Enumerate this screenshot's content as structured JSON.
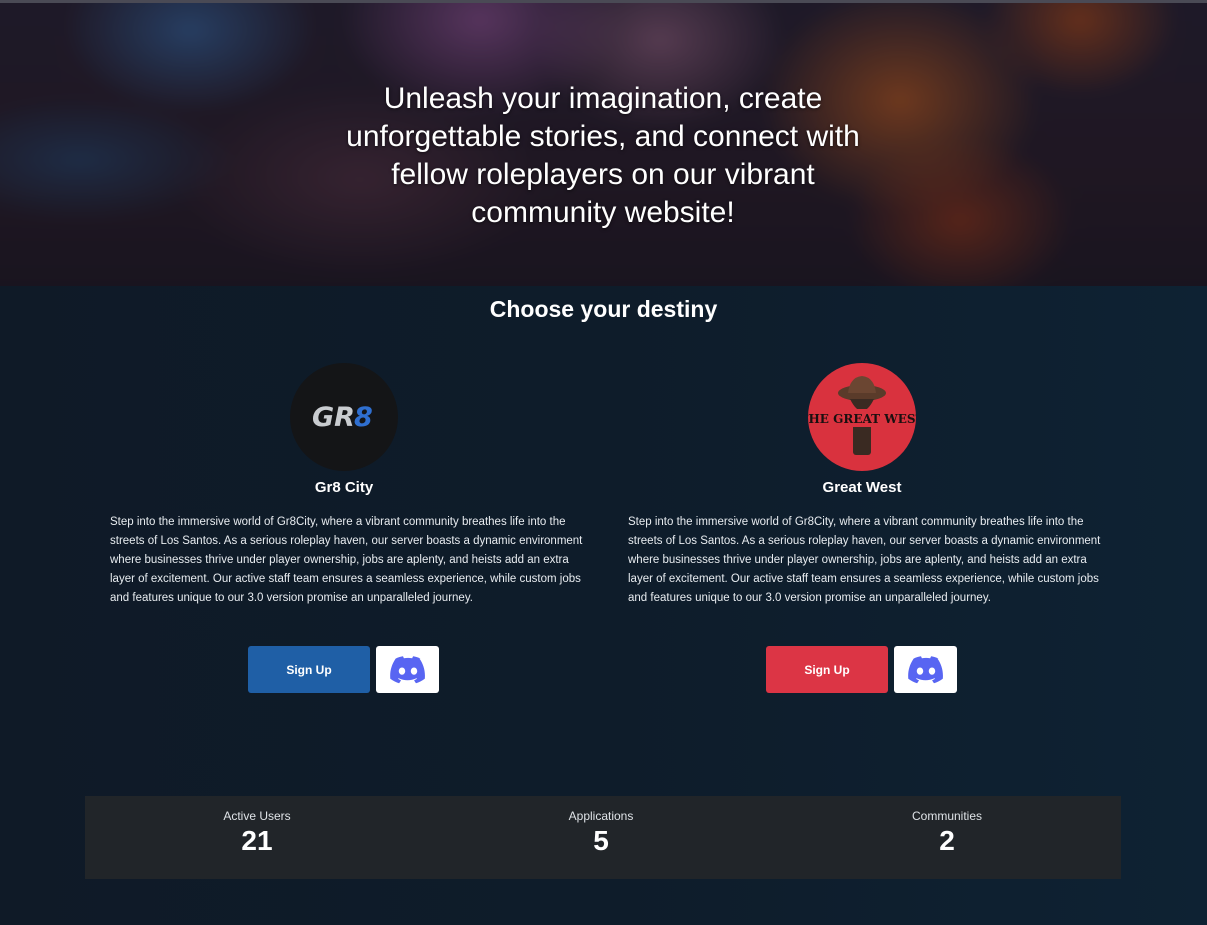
{
  "hero": {
    "tagline": "Unleash your imagination, create unforgettable stories, and connect with fellow roleplayers on our vibrant community website!"
  },
  "section": {
    "title": "Choose your destiny"
  },
  "communities": [
    {
      "name": "Gr8 City",
      "logo_text": "GR8",
      "description": "Step into the immersive world of Gr8City, where a vibrant community breathes life into the streets of Los Santos. As a serious roleplay haven, our server boasts a dynamic environment where businesses thrive under player ownership, jobs are aplenty, and heists add an extra layer of excitement. Our active staff team ensures a seamless experience, while custom jobs and features unique to our 3.0 version promise an unparalleled journey.",
      "signup_label": "Sign Up",
      "accent": "#1f5fa6"
    },
    {
      "name": "Great West",
      "logo_text": "The Great West",
      "description": "Step into the immersive world of Gr8City, where a vibrant community breathes life into the streets of Los Santos. As a serious roleplay haven, our server boasts a dynamic environment where businesses thrive under player ownership, jobs are aplenty, and heists add an extra layer of excitement. Our active staff team ensures a seamless experience, while custom jobs and features unique to our 3.0 version promise an unparalleled journey.",
      "signup_label": "Sign Up",
      "accent": "#dc3545"
    }
  ],
  "stats": [
    {
      "label": "Active Users",
      "value": "21"
    },
    {
      "label": "Applications",
      "value": "5"
    },
    {
      "label": "Communities",
      "value": "2"
    }
  ],
  "colors": {
    "discord": "#5865f2",
    "stats_bg": "#212529"
  }
}
